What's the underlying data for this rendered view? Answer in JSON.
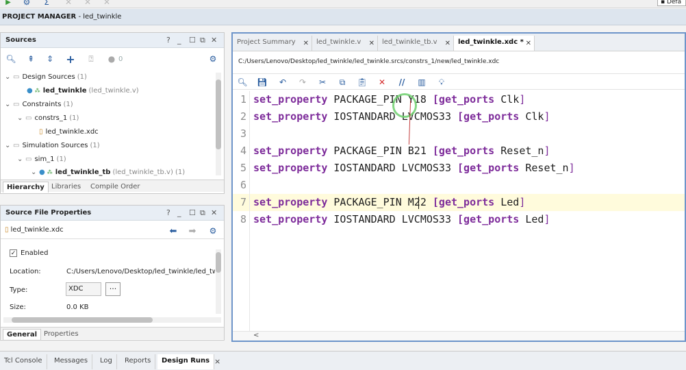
{
  "window": {
    "title_bold": "PROJECT MANAGER",
    "title_rest": " - led_twinkle",
    "top_right_button": "Defa"
  },
  "sources": {
    "title": "Sources",
    "count_badge": "0",
    "tree": [
      {
        "label": "Design Sources",
        "sub": "(1)"
      },
      {
        "label": "led_twinkle",
        "sub": "(led_twinkle.v)"
      },
      {
        "label": "Constraints",
        "sub": "(1)"
      },
      {
        "label": "constrs_1",
        "sub": "(1)"
      },
      {
        "label": "led_twinkle.xdc",
        "sub": ""
      },
      {
        "label": "Simulation Sources",
        "sub": "(1)"
      },
      {
        "label": "sim_1",
        "sub": "(1)"
      },
      {
        "label": "led_twinkle_tb",
        "sub": "(led_twinkle_tb.v) (1)"
      }
    ],
    "tabs": [
      "Hierarchy",
      "Libraries",
      "Compile Order"
    ]
  },
  "props": {
    "title": "Source File Properties",
    "file": "led_twinkle.xdc",
    "enabled_label": "Enabled",
    "location_label": "Location:",
    "location_value": "C:/Users/Lenovo/Desktop/led_twinkle/led_twink",
    "type_label": "Type:",
    "type_value": "XDC",
    "type_more": "···",
    "size_label": "Size:",
    "size_value": "0.0 KB",
    "tabs": [
      "General",
      "Properties"
    ]
  },
  "editor": {
    "tabs": [
      "Project Summary",
      "led_twinkle.v",
      "led_twinkle_tb.v",
      "led_twinkle.xdc *"
    ],
    "path": "C:/Users/Lenovo/Desktop/led_twinkle/led_twinkle.srcs/constrs_1/new/led_twinkle.xdc",
    "lines": [
      {
        "n": "1",
        "kw": "set_property",
        "mid": " PACKAGE_PIN Y18 ",
        "cmd": "[get_ports",
        "arg": " Clk",
        "end": "]"
      },
      {
        "n": "2",
        "kw": "set_property",
        "mid": " IOSTANDARD LVCMOS33 ",
        "cmd": "[get_ports",
        "arg": " Clk",
        "end": "]"
      },
      {
        "n": "3",
        "kw": "",
        "mid": "",
        "cmd": "",
        "arg": "",
        "end": ""
      },
      {
        "n": "4",
        "kw": "set_property",
        "mid": " PACKAGE_PIN B21 ",
        "cmd": "[get_ports",
        "arg": " Reset_n",
        "end": "]"
      },
      {
        "n": "5",
        "kw": "set_property",
        "mid": " IOSTANDARD LVCMOS33 ",
        "cmd": "[get_ports",
        "arg": " Reset_n",
        "end": "]"
      },
      {
        "n": "6",
        "kw": "",
        "mid": "",
        "cmd": "",
        "arg": "",
        "end": ""
      },
      {
        "n": "7",
        "kw": "set_property",
        "mid": " PACKAGE_PIN M22 ",
        "cmd": "[get_ports",
        "arg": " Led",
        "end": "]"
      },
      {
        "n": "8",
        "kw": "set_property",
        "mid": " IOSTANDARD LVCMOS33 ",
        "cmd": "[get_ports",
        "arg": " Led",
        "end": "]"
      }
    ],
    "scroll_left": "<"
  },
  "bottom": {
    "tabs": [
      "Tcl Console",
      "Messages",
      "Log",
      "Reports",
      "Design Runs"
    ],
    "close": "×"
  }
}
